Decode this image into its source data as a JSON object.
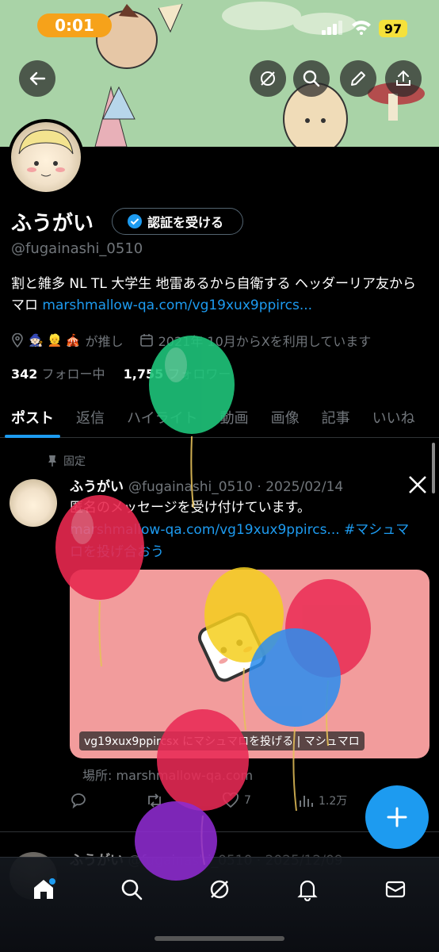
{
  "status_bar": {
    "time": "0:01",
    "battery": "97"
  },
  "profile": {
    "display_name": "ふうがい",
    "verify_button": "認証を受ける",
    "handle": "@fugainashi_0510",
    "bio_text": "割と雑多 NL TL 大学生 地雷あるから自衛する ヘッダーリア友から マロ ",
    "bio_link": "marshmallow-qa.com/vg19xux9ppircs...",
    "oshi_label": "が推し",
    "joined": "2021年 10月からXを利用しています",
    "following_count": "342",
    "following_label": "フォロー中",
    "followers_count": "1,755",
    "followers_label": "フォロワー"
  },
  "tabs": [
    "ポスト",
    "返信",
    "ハイライト",
    "動画",
    "画像",
    "記事",
    "いいね"
  ],
  "pinned_post": {
    "pinned_label": "固定",
    "author": "ふうがい",
    "handle_date": "@fugainashi_0510 · 2025/02/14",
    "text": "匿名のメッセージを受け付けています。",
    "link": "marshmallow-qa.com/vg19xux9ppircs...",
    "hashtag": "#マシュマロを投げ合おう",
    "card_title": "vg19xux9ppircsx にマシュマロを投げる | マシュマロ",
    "card_source": "場所: marshmallow-qa.com",
    "likes": "7",
    "views": "1.2万"
  },
  "next_post": {
    "author": "ふうがい",
    "handle_date": "@fugainashi_0510 · 2025/12/09"
  },
  "colors": {
    "accent": "#1d9bf0",
    "timepill": "#f6a21a",
    "battery": "#f5e13b",
    "card_bg": "#f29c9c"
  },
  "icons": [
    "back-arrow-icon",
    "grok-icon",
    "search-icon",
    "edit-icon",
    "share-icon",
    "verified-badge-icon",
    "location-icon",
    "calendar-icon",
    "pin-icon",
    "x-logo-icon",
    "reply-icon",
    "repost-icon",
    "like-icon",
    "views-icon",
    "plus-icon",
    "home-icon",
    "search-nav-icon",
    "grok-nav-icon",
    "notifications-icon",
    "messages-icon"
  ]
}
